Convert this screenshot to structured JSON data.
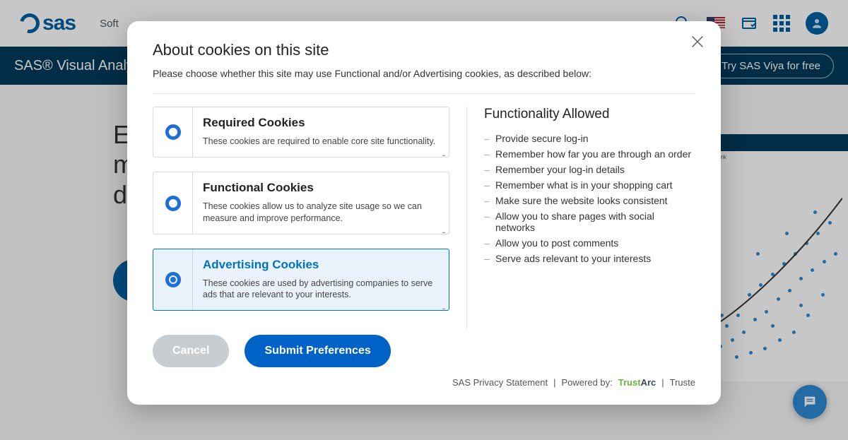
{
  "header": {
    "logo": "sas",
    "nav": [
      "Soft",
      "",
      "",
      "",
      ""
    ],
    "try_label": "Try SAS Viya for free"
  },
  "bluebar": {
    "title": "SAS® Visual Analyt"
  },
  "hero": {
    "line1": "E",
    "line2": "m",
    "line3": "da"
  },
  "chart_stub": {
    "brand": "AquaBank"
  },
  "modal": {
    "title": "About cookies on this site",
    "subtitle": "Please choose whether this site may use Functional and/or Advertising cookies, as described below:",
    "cards": [
      {
        "title": "Required Cookies",
        "desc": "These cookies are required to enable core site functionality.",
        "selected": false
      },
      {
        "title": "Functional Cookies",
        "desc": "These cookies allow us to analyze site usage so we can measure and improve performance.",
        "selected": false
      },
      {
        "title": "Advertising Cookies",
        "desc": "These cookies are used by advertising companies to serve ads that are relevant to your interests.",
        "selected": true
      }
    ],
    "functionality_heading": "Functionality Allowed",
    "functionality_list": [
      "Provide secure log-in",
      "Remember how far you are through an order",
      "Remember your log-in details",
      "Remember what is in your shopping cart",
      "Make sure the website looks consistent",
      "Allow you to share pages with social networks",
      "Allow you to post comments",
      "Serve ads relevant to your interests"
    ],
    "cancel": "Cancel",
    "submit": "Submit Preferences",
    "footer": {
      "privacy": "SAS Privacy Statement",
      "powered": "Powered by:",
      "truste": "Truste"
    }
  }
}
